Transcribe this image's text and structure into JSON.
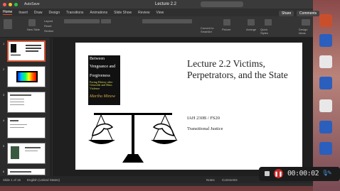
{
  "titlebar": {
    "autosave": "AutoSave",
    "doc_title": "Lecture 2.2"
  },
  "tabs": [
    "Home",
    "Insert",
    "Draw",
    "Design",
    "Transitions",
    "Animations",
    "Slide Show",
    "Review",
    "View"
  ],
  "share_label": "Share",
  "comments_label": "Comments",
  "ribbon": {
    "new_slide": "New Slide",
    "layout": "Layout",
    "reset": "Reset",
    "section": "Section",
    "convert": "Convert to SmartArt",
    "picture": "Picture",
    "arrange": "Arrange",
    "quick_styles": "Quick Styles",
    "design_ideas": "Design Ideas"
  },
  "thumbnails": [
    "1",
    "2",
    "3",
    "4",
    "5",
    "6"
  ],
  "slide": {
    "book": {
      "line1": "Between",
      "line2": "Vengeance and",
      "line3": "Forgiveness",
      "subtitle": "Facing History after Genocide and Mass Violence",
      "author": "Martha Minow"
    },
    "title": "Lecture 2.2 Victims, Perpetrators, and the State",
    "course": "IAH 230B / FS20",
    "topic": "Transitional Justice"
  },
  "status": {
    "slide_of": "Slide 1 of 15",
    "language": "English (United States)",
    "notes": "Notes",
    "comments": "Comments"
  },
  "recorder": {
    "time": "00:00:02"
  },
  "colors": {
    "accent": "#d35230",
    "record": "#c62828"
  }
}
